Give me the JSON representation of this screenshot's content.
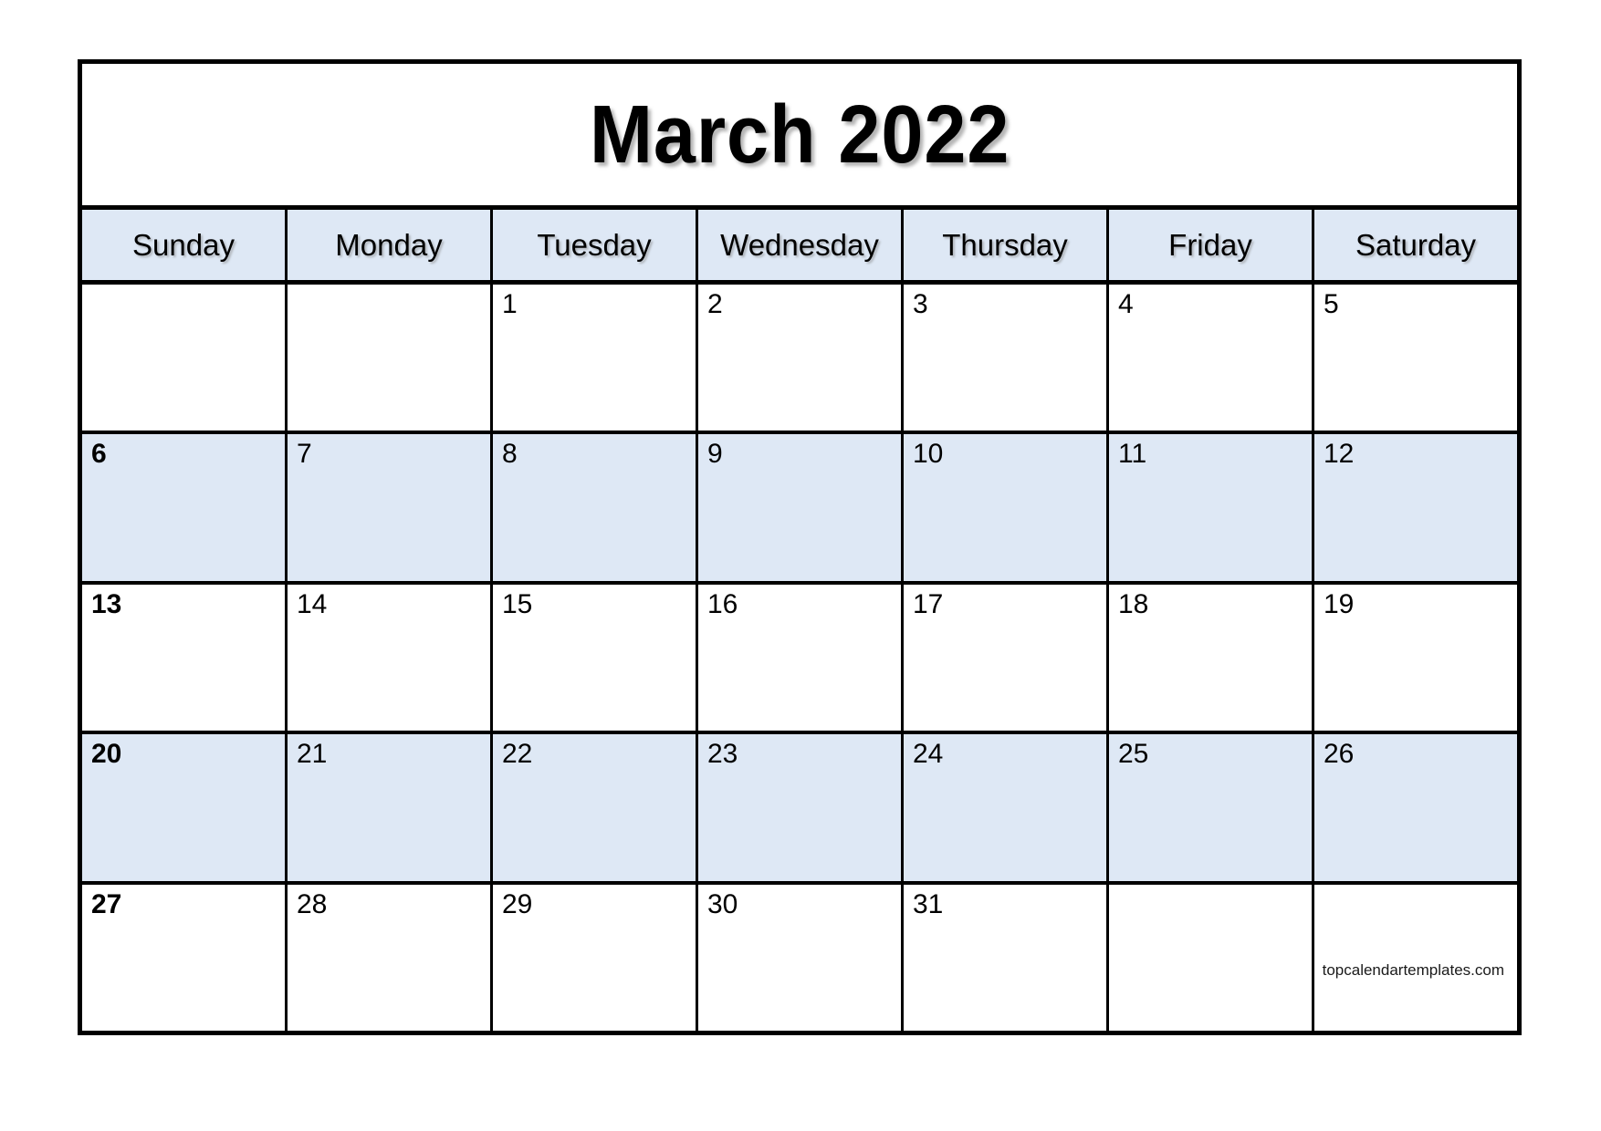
{
  "calendar": {
    "title": "March 2022",
    "month": "March",
    "year": "2022",
    "weekday_headers": [
      "Sunday",
      "Monday",
      "Tuesday",
      "Wednesday",
      "Thursday",
      "Friday",
      "Saturday"
    ],
    "weeks": [
      {
        "shaded": false,
        "days": [
          {
            "num": ""
          },
          {
            "num": ""
          },
          {
            "num": "1"
          },
          {
            "num": "2"
          },
          {
            "num": "3"
          },
          {
            "num": "4"
          },
          {
            "num": "5"
          }
        ]
      },
      {
        "shaded": true,
        "days": [
          {
            "num": "6",
            "bold": true
          },
          {
            "num": "7"
          },
          {
            "num": "8"
          },
          {
            "num": "9"
          },
          {
            "num": "10"
          },
          {
            "num": "11"
          },
          {
            "num": "12"
          }
        ]
      },
      {
        "shaded": false,
        "days": [
          {
            "num": "13",
            "bold": true
          },
          {
            "num": "14"
          },
          {
            "num": "15"
          },
          {
            "num": "16"
          },
          {
            "num": "17"
          },
          {
            "num": "18"
          },
          {
            "num": "19"
          }
        ]
      },
      {
        "shaded": true,
        "days": [
          {
            "num": "20",
            "bold": true
          },
          {
            "num": "21"
          },
          {
            "num": "22"
          },
          {
            "num": "23"
          },
          {
            "num": "24"
          },
          {
            "num": "25"
          },
          {
            "num": "26"
          }
        ]
      },
      {
        "shaded": false,
        "days": [
          {
            "num": "27",
            "bold": true
          },
          {
            "num": "28"
          },
          {
            "num": "29"
          },
          {
            "num": "30"
          },
          {
            "num": "31"
          },
          {
            "num": ""
          },
          {
            "num": ""
          }
        ]
      }
    ],
    "watermark": "topcalendartemplates.com",
    "colors": {
      "shaded_row": "#dee8f5",
      "header_background": "#dee8f5",
      "border": "#000000",
      "page_background": "#ffffff",
      "text": "#000000"
    }
  }
}
